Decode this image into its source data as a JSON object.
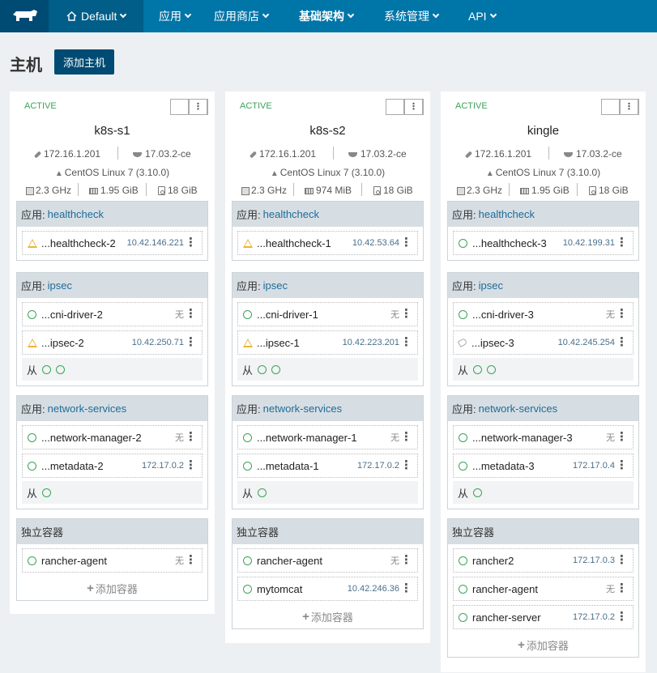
{
  "nav": {
    "env_label": "Default",
    "items": [
      "应用",
      "应用商店",
      "基础架构",
      "系统管理",
      "API"
    ]
  },
  "page": {
    "title": "主机",
    "add_host_label": "添加主机"
  },
  "labels": {
    "stack_prefix": "应用: ",
    "standalone": "独立容器",
    "add_container": "添加容器",
    "slave": "从"
  },
  "colors": {
    "nav_bg": "#0075a8",
    "nav_dark": "#004b73",
    "active": "#3ca35a",
    "warning": "#e8b53a",
    "link": "#1e6b99"
  },
  "hosts": [
    {
      "state": "ACTIVE",
      "name": "k8s-s1",
      "ip": "172.16.1.201",
      "docker": "17.03.2-ce",
      "os": "CentOS Linux 7 (3.10.0)",
      "cpu": "2.3 GHz",
      "mem": "1.95 GiB",
      "disk": "18 GiB",
      "healthcheck": {
        "name": "healthcheck",
        "containers": [
          {
            "name": "...healthcheck-2",
            "ip": "10.42.146.221",
            "icon": "warning"
          }
        ]
      },
      "ipsec": {
        "name": "ipsec",
        "containers": [
          {
            "name": "...cni-driver-2",
            "ip": "无",
            "icon": "ring"
          },
          {
            "name": "...ipsec-2",
            "ip": "10.42.250.71",
            "icon": "warning"
          }
        ]
      },
      "netsvc": {
        "name": "network-services",
        "containers": [
          {
            "name": "...network-manager-2",
            "ip": "无",
            "icon": "ring"
          },
          {
            "name": "...metadata-2",
            "ip": "172.17.0.2",
            "icon": "ring"
          }
        ]
      },
      "standalone": [
        {
          "name": "rancher-agent",
          "ip": "无",
          "icon": "ring"
        }
      ]
    },
    {
      "state": "ACTIVE",
      "name": "k8s-s2",
      "ip": "172.16.1.201",
      "docker": "17.03.2-ce",
      "os": "CentOS Linux 7 (3.10.0)",
      "cpu": "2.3 GHz",
      "mem": "974 MiB",
      "disk": "18 GiB",
      "healthcheck": {
        "name": "healthcheck",
        "containers": [
          {
            "name": "...healthcheck-1",
            "ip": "10.42.53.64",
            "icon": "warning"
          }
        ]
      },
      "ipsec": {
        "name": "ipsec",
        "containers": [
          {
            "name": "...cni-driver-1",
            "ip": "无",
            "icon": "ring"
          },
          {
            "name": "...ipsec-1",
            "ip": "10.42.223.201",
            "icon": "warning"
          }
        ]
      },
      "netsvc": {
        "name": "network-services",
        "containers": [
          {
            "name": "...network-manager-1",
            "ip": "无",
            "icon": "ring"
          },
          {
            "name": "...metadata-1",
            "ip": "172.17.0.2",
            "icon": "ring"
          }
        ]
      },
      "standalone": [
        {
          "name": "rancher-agent",
          "ip": "无",
          "icon": "ring"
        },
        {
          "name": "mytomcat",
          "ip": "10.42.246.36",
          "icon": "ring"
        }
      ]
    },
    {
      "state": "ACTIVE",
      "name": "kingle",
      "ip": "172.16.1.201",
      "docker": "17.03.2-ce",
      "os": "CentOS Linux 7 (3.10.0)",
      "cpu": "2.3 GHz",
      "mem": "1.95 GiB",
      "disk": "18 GiB",
      "healthcheck": {
        "name": "healthcheck",
        "containers": [
          {
            "name": "...healthcheck-3",
            "ip": "10.42.199.31",
            "icon": "ring"
          }
        ]
      },
      "ipsec": {
        "name": "ipsec",
        "containers": [
          {
            "name": "...cni-driver-3",
            "ip": "无",
            "icon": "ring"
          },
          {
            "name": "...ipsec-3",
            "ip": "10.42.245.254",
            "icon": "tag"
          }
        ]
      },
      "netsvc": {
        "name": "network-services",
        "containers": [
          {
            "name": "...network-manager-3",
            "ip": "无",
            "icon": "ring"
          },
          {
            "name": "...metadata-3",
            "ip": "172.17.0.4",
            "icon": "ring"
          }
        ]
      },
      "standalone": [
        {
          "name": "rancher2",
          "ip": "172.17.0.3",
          "icon": "ring"
        },
        {
          "name": "rancher-agent",
          "ip": "无",
          "icon": "ring"
        },
        {
          "name": "rancher-server",
          "ip": "172.17.0.2",
          "icon": "ring"
        }
      ]
    }
  ]
}
